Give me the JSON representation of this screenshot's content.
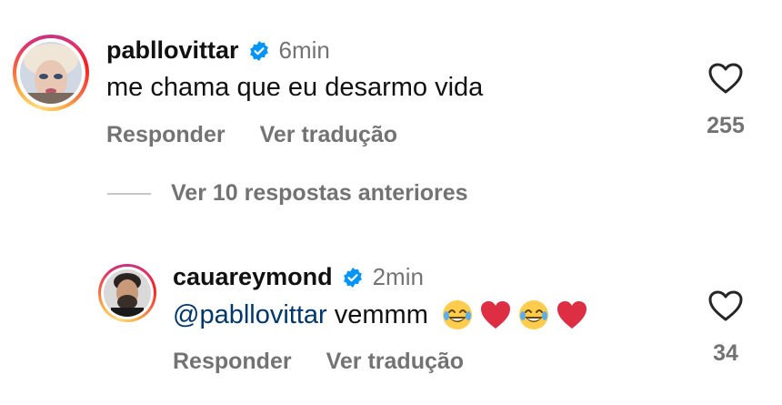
{
  "comments": [
    {
      "username": "pabllovittar",
      "time": "6min",
      "text": "me chama que eu desarmo vida",
      "reply_label": "Responder",
      "translate_label": "Ver tradução",
      "likes": "255"
    },
    {
      "username": "cauareymond",
      "time": "2min",
      "mention": "@pabllovittar",
      "text": " vemmm",
      "reply_label": "Responder",
      "translate_label": "Ver tradução",
      "likes": "34"
    }
  ],
  "view_replies": "Ver 10 respostas anteriores",
  "colors": {
    "verified_blue": "#0095f6",
    "secondary_text": "#737373",
    "mention": "#00376b"
  },
  "icons": [
    "verified-badge-icon",
    "heart-icon",
    "laughing-emoji",
    "red-heart-emoji"
  ]
}
